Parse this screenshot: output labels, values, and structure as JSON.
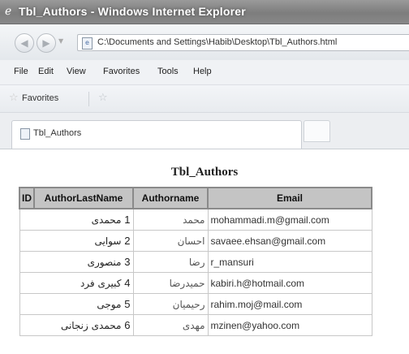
{
  "window": {
    "title": "Tbl_Authors - Windows Internet Explorer"
  },
  "address_bar": {
    "url": "C:\\Documents and Settings\\Habib\\Desktop\\Tbl_Authors.html"
  },
  "menu": [
    "File",
    "Edit",
    "View",
    "Favorites",
    "Tools",
    "Help"
  ],
  "favorites_bar": {
    "label": "Favorites"
  },
  "tab": {
    "label": "Tbl_Authors"
  },
  "table": {
    "caption": "Tbl_Authors",
    "headers": [
      "ID",
      "AuthorLastName",
      "Authorname",
      "Email"
    ],
    "rows": [
      {
        "id": "1",
        "last": "محمدی",
        "name": "محمد",
        "email": "mohammadi.m@gmail.com"
      },
      {
        "id": "2",
        "last": "سوایی",
        "name": "احسان",
        "email": "savaee.ehsan@gmail.com"
      },
      {
        "id": "3",
        "last": "منصوری",
        "name": "رضا",
        "email": "r_mansuri"
      },
      {
        "id": "4",
        "last": "کبیری فرد",
        "name": "حمیدرضا",
        "email": "kabiri.h@hotmail.com"
      },
      {
        "id": "5",
        "last": "موجی",
        "name": "رحیمیان",
        "email": "rahim.moj@mail.com"
      },
      {
        "id": "6",
        "last": "محمدی زنجانی",
        "name": "مهدی",
        "email": "mzinen@yahoo.com"
      }
    ]
  },
  "icons": {
    "app": "ie-logo-icon",
    "back": "back-arrow-icon",
    "forward": "forward-arrow-icon",
    "page": "page-icon",
    "favorites": "favorites-star-icon",
    "add_favorite": "add-favorite-icon"
  }
}
